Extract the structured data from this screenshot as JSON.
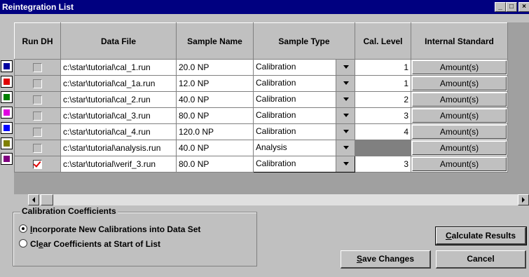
{
  "window": {
    "title": "Reintegration List"
  },
  "columns": {
    "run_dh": "Run DH",
    "data_file": "Data File",
    "sample_name": "Sample Name",
    "sample_type": "Sample Type",
    "cal_level": "Cal. Level",
    "internal_standard": "Internal Standard"
  },
  "rows": [
    {
      "color": "#0000a0",
      "checked": false,
      "data_file": "c:\\star\\tutorial\\cal_1.run",
      "sample_name": "20.0 NP",
      "sample_type": "Calibration",
      "cal_level": "1",
      "istd": "Amount(s)"
    },
    {
      "color": "#e00000",
      "checked": false,
      "data_file": "c:\\star\\tutorial\\cal_1a.run",
      "sample_name": "12.0 NP",
      "sample_type": "Calibration",
      "cal_level": "1",
      "istd": "Amount(s)"
    },
    {
      "color": "#008000",
      "checked": false,
      "data_file": "c:\\star\\tutorial\\cal_2.run",
      "sample_name": "40.0 NP",
      "sample_type": "Calibration",
      "cal_level": "2",
      "istd": "Amount(s)"
    },
    {
      "color": "#e000e0",
      "checked": false,
      "data_file": "c:\\star\\tutorial\\cal_3.run",
      "sample_name": "80.0 NP",
      "sample_type": "Calibration",
      "cal_level": "3",
      "istd": "Amount(s)"
    },
    {
      "color": "#0000ff",
      "checked": false,
      "data_file": "c:\\star\\tutorial\\cal_4.run",
      "sample_name": "120.0 NP",
      "sample_type": "Calibration",
      "cal_level": "4",
      "istd": "Amount(s)"
    },
    {
      "color": "#808000",
      "checked": false,
      "data_file": "c:\\star\\tutorial\\analysis.run",
      "sample_name": "40.0 NP",
      "sample_type": "Analysis",
      "cal_level": "",
      "istd": "Amount(s)"
    },
    {
      "color": "#800080",
      "checked": true,
      "data_file": "c:\\star\\tutorial\\verif_3.run",
      "sample_name": "80.0 NP",
      "sample_type": "Calibration",
      "cal_level": "3",
      "istd": "Amount(s)"
    }
  ],
  "calibration": {
    "title": "Calibration Coefficients",
    "option1_pre": "",
    "option1_u": "I",
    "option1_post": "ncorporate New Calibrations into Data Set",
    "option2_pre": "Cl",
    "option2_u": "e",
    "option2_post": "ar Coefficients at Start of List",
    "selected": 1
  },
  "buttons": {
    "calculate_u": "C",
    "calculate_rest": "alculate Results",
    "save_u": "S",
    "save_rest": "ave Changes",
    "cancel": "Cancel"
  },
  "title_buttons": {
    "minimize": "_",
    "maximize": "□",
    "close": "×"
  }
}
